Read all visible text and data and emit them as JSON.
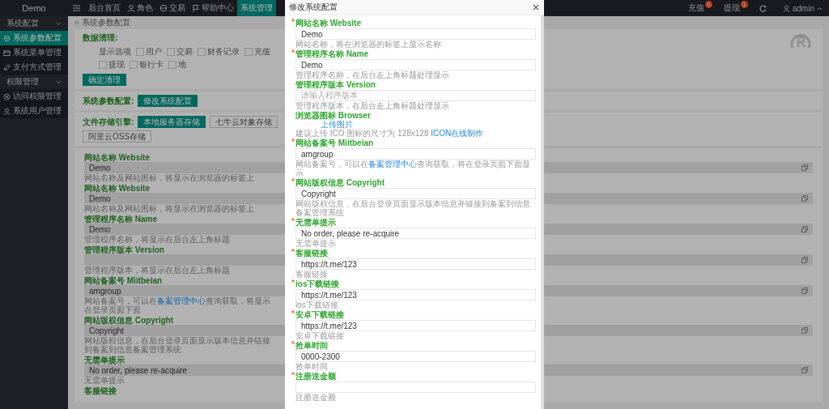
{
  "brand": "Demo",
  "top_nav": {
    "items": [
      {
        "label": "后台首页",
        "selected": false
      },
      {
        "label": "角色",
        "selected": false
      },
      {
        "label": "交易",
        "selected": false
      },
      {
        "label": "帮助中心",
        "selected": false
      },
      {
        "label": "系统管理",
        "selected": true
      }
    ],
    "counters": [
      {
        "label": "充值",
        "badge": "0"
      },
      {
        "label": "提现",
        "badge": "1"
      }
    ],
    "user": "admin"
  },
  "sidebar": {
    "groups": [
      {
        "label": "系统配置",
        "expanded": true,
        "children": [
          {
            "label": "系统参数配置",
            "selected": true
          },
          {
            "label": "系统菜单管理",
            "selected": false
          },
          {
            "label": "支付方式管理",
            "selected": false
          }
        ]
      },
      {
        "label": "权限管理",
        "expanded": true,
        "children": [
          {
            "label": "访问权限管理",
            "selected": false
          },
          {
            "label": "系统用户管理",
            "selected": false
          }
        ]
      }
    ]
  },
  "breadcrumb": "系统参数配置",
  "cleanup": {
    "label": "数据清理:",
    "options_label": "显示选项",
    "options": [
      {
        "label": "用户",
        "checked": false
      },
      {
        "label": "交易",
        "checked": false
      },
      {
        "label": "财务记录",
        "checked": false
      },
      {
        "label": "充值",
        "checked": false
      },
      {
        "label": "提现",
        "checked": false
      },
      {
        "label": "银行卡",
        "checked": false
      },
      {
        "label": "地",
        "checked": false
      }
    ],
    "button": "确定清理"
  },
  "config": {
    "label": "系统参数配置:",
    "button": "修改系统配置"
  },
  "storage": {
    "label": "文件存储引擎:",
    "engines": [
      {
        "label": "本地服务器存储",
        "selected": true
      },
      {
        "label": "七牛云对象存储",
        "selected": false
      },
      {
        "label": "阿里云OSS存储",
        "selected": false
      }
    ]
  },
  "settings": [
    {
      "label": "网站名称 Website",
      "value": "Demo",
      "help": "网站名称及网站图标，将显示在浏览器的标签上"
    },
    {
      "label": "网站名称 Website",
      "value": "Demo",
      "help": "网站名称及网站图标，将显示在浏览器的标签上"
    },
    {
      "label": "管理程序名称 Name",
      "value": "Demo",
      "help": "管理程序名称，将显示在后台左上角标题"
    },
    {
      "label": "管理程序版本 Version",
      "help": "管理程序版本，将显示在后台左上角标题"
    },
    {
      "label": "网站备案号 Miitbeian",
      "value": "amgroup",
      "help": "网站备案号，可以在",
      "help_link": "备案管理中心",
      "help_tail": "查询获取，将显示在登录页面下面"
    },
    {
      "label": "网站版权信息 Copyright",
      "value": "Copyright",
      "help": "网站版权信息，在后台登录页面显示版本信息并链接到备案到信息备案管理系统"
    },
    {
      "label": "无需单提示",
      "value": "No order, please re-acquire",
      "help": "无需单提示"
    },
    {
      "label": "客服链接"
    }
  ],
  "modal": {
    "title": "修改系统配置",
    "fields": [
      {
        "kind": "input",
        "required": true,
        "label": "网站名称 Website",
        "value": "Demo",
        "help": "网站名称，将在浏览器的标签上显示名称"
      },
      {
        "kind": "input",
        "required": true,
        "label": "管理程序名称 Name",
        "value": "Demo",
        "help": "管理程序名称，在后台左上角标题处理显示"
      },
      {
        "kind": "input",
        "required": false,
        "label": "管理程序版本 Version",
        "placeholder": "请输入程序版本",
        "help": "管理程序版本，在后台左上角标题处理显示"
      },
      {
        "kind": "upload",
        "required": false,
        "label": "浏览器图标 Browser",
        "link": "上传图片",
        "help": "建议上传 ICO 图标的尺寸为 128x128 ",
        "help_link": "ICON在线制作"
      },
      {
        "kind": "input",
        "required": true,
        "label": "网站备案号 Miitbeian",
        "value": "amgroup",
        "help": "网站备案号，可以在",
        "help_link": "备案管理中心",
        "help_tail": "查询获取，将在登录页面下面显示"
      },
      {
        "kind": "input",
        "required": true,
        "label": "网站版权信息 Copyright",
        "value": "Copyright",
        "help": "网站版权信息，在后台登录页面显示版本信息并链接到备案到信息备案管理系统"
      },
      {
        "kind": "input",
        "required": true,
        "label": "无需单提示",
        "value": "No order, please re-acquire",
        "help": "无需单提示"
      },
      {
        "kind": "input",
        "required": true,
        "label": "客服链接",
        "value": "https://t.me/123",
        "help": "客服链接"
      },
      {
        "kind": "input",
        "required": true,
        "label": "ios下载链接",
        "value": "https://t.me/123",
        "help": "ios下载链接"
      },
      {
        "kind": "input",
        "required": true,
        "label": "安卓下载链接",
        "value": "https://t.me/123",
        "help": "安卓下载链接"
      },
      {
        "kind": "input",
        "required": true,
        "label": "抢单时间",
        "value": "0000-2300",
        "help": "抢单时间"
      },
      {
        "kind": "input",
        "required": true,
        "label": "注册送金额",
        "help": "注册送金额"
      }
    ]
  }
}
